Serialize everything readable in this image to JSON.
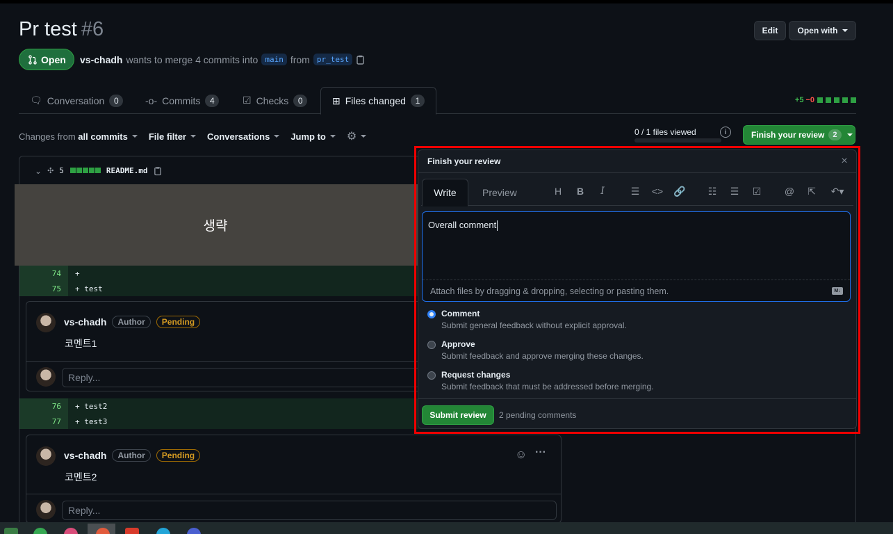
{
  "pr": {
    "title": "Pr test",
    "number": "#6",
    "state": "Open",
    "author": "vs-chadh",
    "merge_text": "wants to merge 4 commits into",
    "base": "main",
    "from_text": "from",
    "head": "pr_test"
  },
  "header_buttons": {
    "edit": "Edit",
    "open_with": "Open with"
  },
  "tabs": [
    {
      "label": "Conversation",
      "count": "0"
    },
    {
      "label": "Commits",
      "count": "4"
    },
    {
      "label": "Checks",
      "count": "0"
    },
    {
      "label": "Files changed",
      "count": "1"
    }
  ],
  "diffstat": {
    "added": "+5",
    "removed": "−0"
  },
  "toolbar": {
    "changes_prefix": "Changes from",
    "changes_value": "all commits",
    "file_filter": "File filter",
    "conversations": "Conversations",
    "jump_to": "Jump to"
  },
  "viewed": "0 / 1 files viewed",
  "finish_button": {
    "label": "Finish your review",
    "count": "2"
  },
  "file": {
    "changes": "5",
    "name": "README.md"
  },
  "omitted": "생략",
  "diff_lines_a": [
    {
      "num": "74",
      "code": "+"
    },
    {
      "num": "75",
      "code": "+ test"
    }
  ],
  "diff_lines_b": [
    {
      "num": "76",
      "code": "+ test2"
    },
    {
      "num": "77",
      "code": "+ test3"
    }
  ],
  "comments": [
    {
      "user": "vs-chadh",
      "role": "Author",
      "status": "Pending",
      "body": "코멘트1"
    },
    {
      "user": "vs-chadh",
      "role": "Author",
      "status": "Pending",
      "body": "코멘트2"
    }
  ],
  "reply_placeholder": "Reply...",
  "review": {
    "title": "Finish your review",
    "tab_write": "Write",
    "tab_preview": "Preview",
    "text": "Overall comment",
    "attach": "Attach files by dragging & dropping, selecting or pasting them.",
    "options": [
      {
        "title": "Comment",
        "desc": "Submit general feedback without explicit approval.",
        "checked": true
      },
      {
        "title": "Approve",
        "desc": "Submit feedback and approve merging these changes.",
        "checked": false
      },
      {
        "title": "Request changes",
        "desc": "Submit feedback that must be addressed before merging.",
        "checked": false
      }
    ],
    "submit": "Submit review",
    "pending": "2 pending comments"
  },
  "colors": {
    "accent_green": "#238636",
    "highlight": "#ee0000",
    "focus": "#1f6feb"
  }
}
